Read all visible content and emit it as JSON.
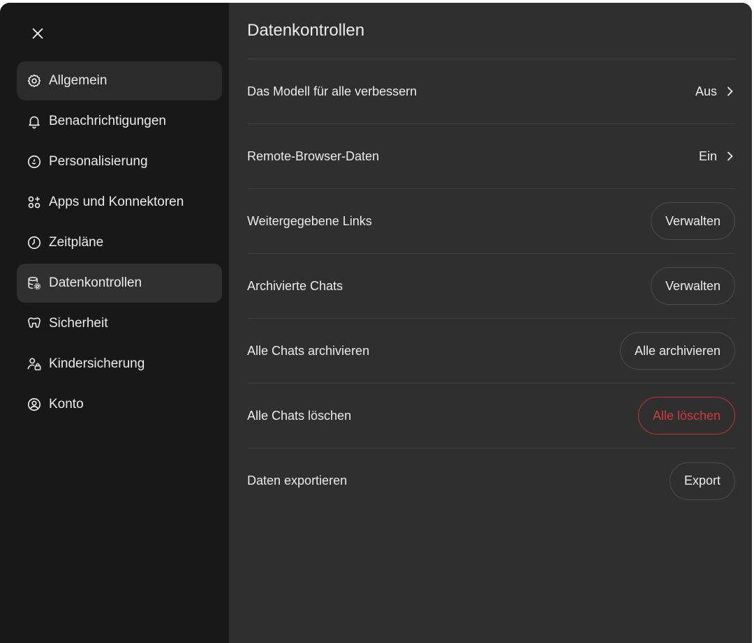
{
  "sidebar": {
    "close_label": "×",
    "items": [
      {
        "label": "Allgemein",
        "icon": "gear-icon"
      },
      {
        "label": "Benachrichtigungen",
        "icon": "bell-icon"
      },
      {
        "label": "Personalisierung",
        "icon": "personalization-icon"
      },
      {
        "label": "Apps und Konnektoren",
        "icon": "apps-icon"
      },
      {
        "label": "Zeitpläne",
        "icon": "clock-icon"
      },
      {
        "label": "Datenkontrollen",
        "icon": "database-gear-icon"
      },
      {
        "label": "Sicherheit",
        "icon": "shield-icon"
      },
      {
        "label": "Kindersicherung",
        "icon": "parental-lock-icon"
      },
      {
        "label": "Konto",
        "icon": "account-icon"
      }
    ],
    "active_item": "Datenkontrollen",
    "hover_item": "Allgemein"
  },
  "main": {
    "title": "Datenkontrollen",
    "rows": [
      {
        "label": "Das Modell für alle verbessern",
        "value": "Aus"
      },
      {
        "label": "Remote-Browser-Daten",
        "value": "Ein"
      },
      {
        "label": "Weitergegebene Links",
        "button": "Verwalten"
      },
      {
        "label": "Archivierte Chats",
        "button": "Verwalten"
      },
      {
        "label": "Alle Chats archivieren",
        "button": "Alle archivieren"
      },
      {
        "label": "Alle Chats löschen",
        "button": "Alle löschen"
      },
      {
        "label": "Daten exportieren",
        "button": "Export"
      }
    ]
  },
  "colors": {
    "sidebar_bg": "#181818",
    "main_bg": "#2f2f2f",
    "text": "#ececec",
    "danger": "#d13b3b"
  }
}
